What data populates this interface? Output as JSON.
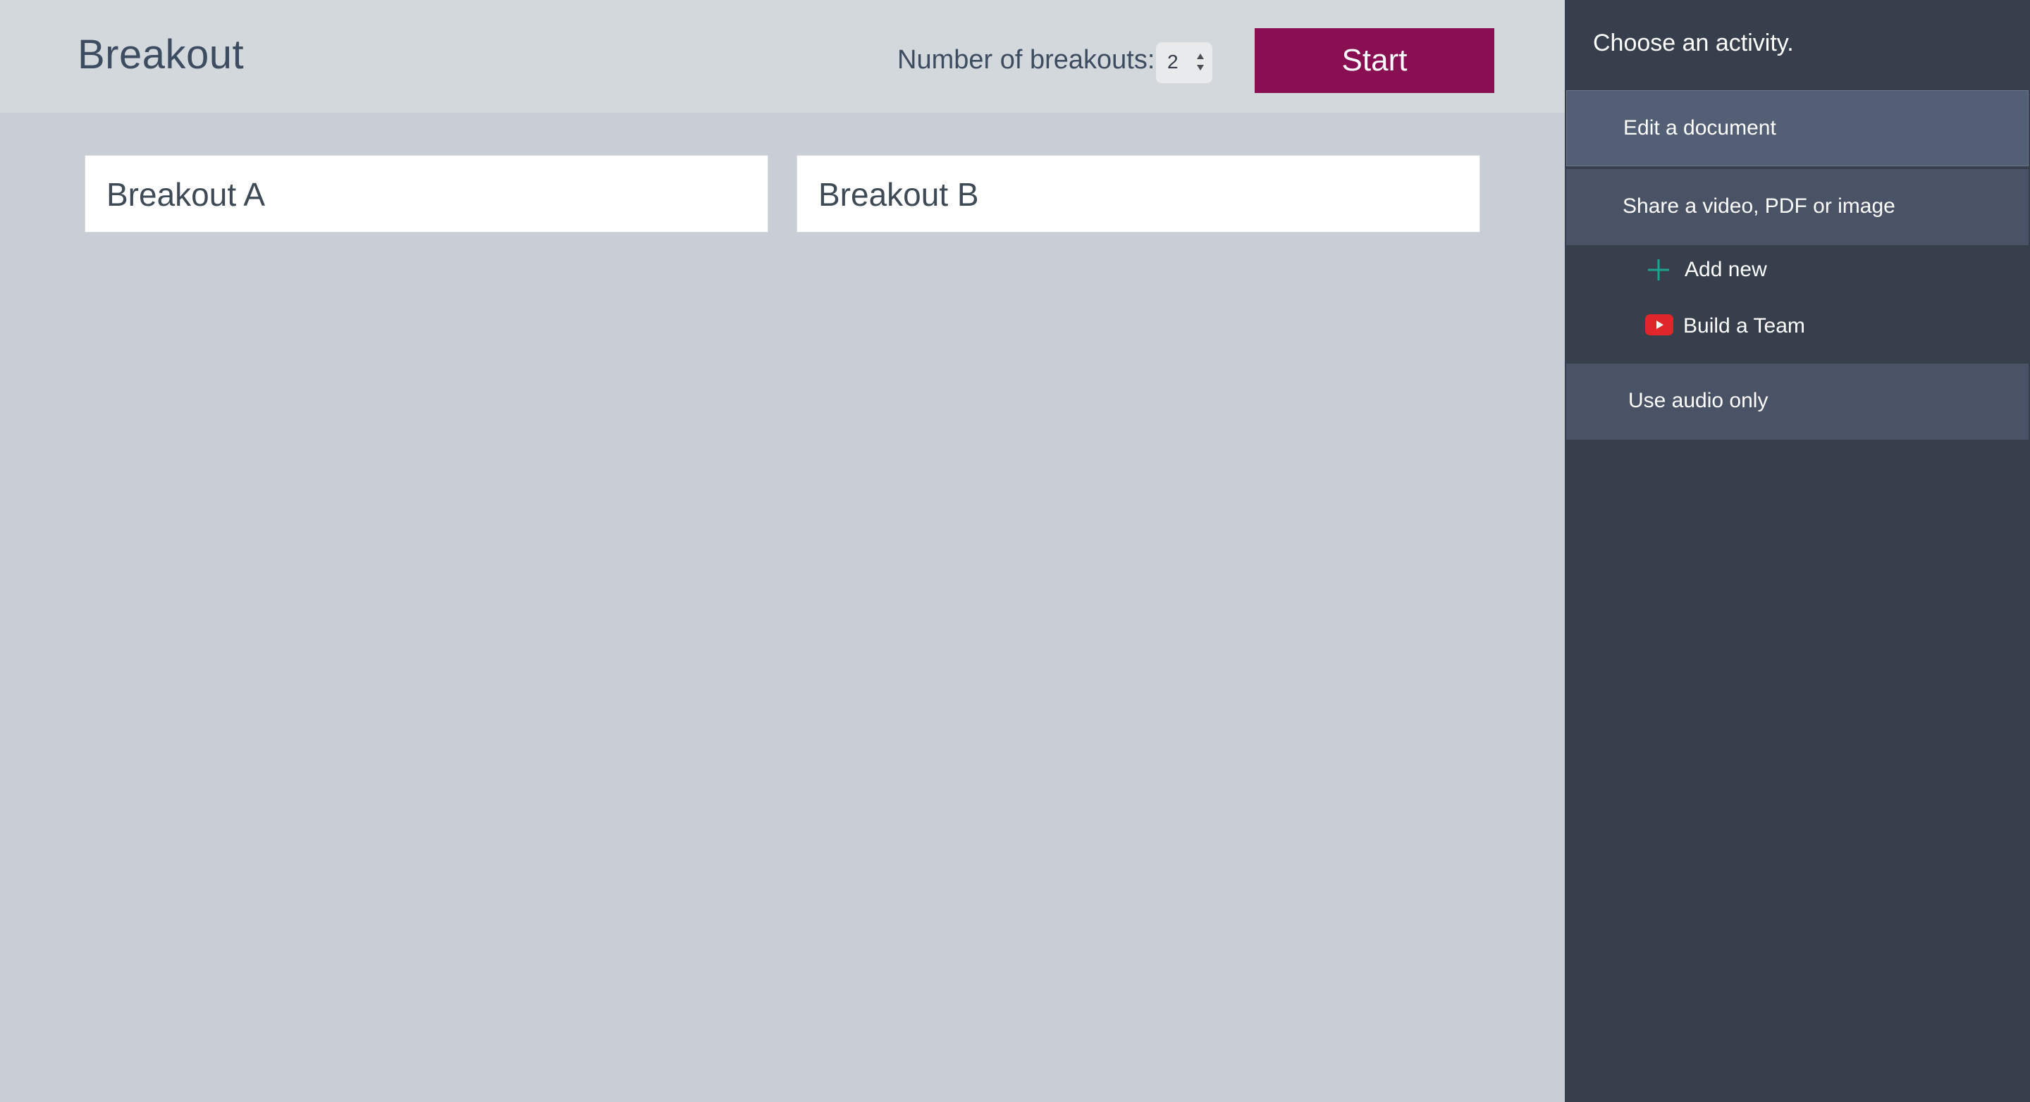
{
  "header": {
    "title": "Breakout",
    "count_label": "Number of breakouts:",
    "count_value": "2",
    "start_label": "Start"
  },
  "rooms": [
    {
      "name": "Breakout A"
    },
    {
      "name": "Breakout B"
    }
  ],
  "sidebar": {
    "heading": "Choose an activity.",
    "activities": [
      {
        "label": "Edit a document",
        "active": true
      },
      {
        "label": "Share a video, PDF or image",
        "active": false
      },
      {
        "label": "Use audio only",
        "active": false
      }
    ],
    "media_items": [
      {
        "label": "Add new",
        "icon": "plus-icon"
      },
      {
        "label": "Build a Team",
        "icon": "youtube-icon"
      }
    ]
  },
  "colors": {
    "accent": "#870f52",
    "sidebar_bg": "#383f4c",
    "plus_icon": "#1aa58e",
    "youtube_icon": "#e0262b"
  }
}
